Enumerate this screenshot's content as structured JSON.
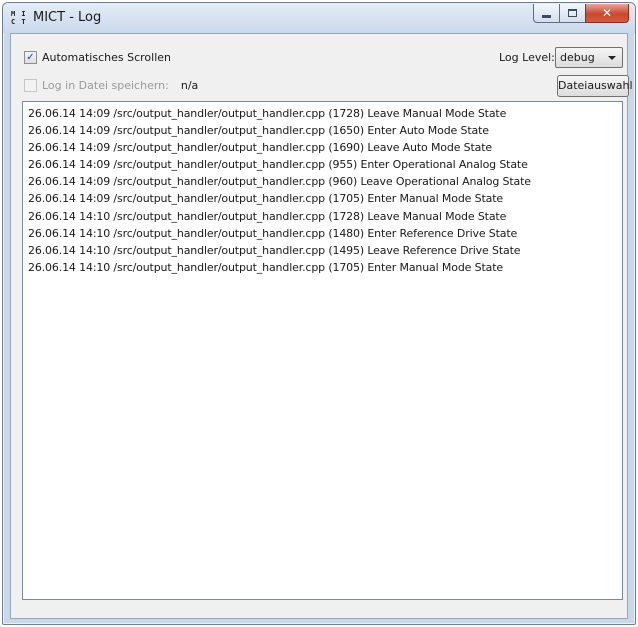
{
  "window": {
    "title": "MICT - Log",
    "app_icon_text": "M I\nC T"
  },
  "controls": {
    "auto_scroll_label": "Automatisches Scrollen",
    "auto_scroll_checked": true,
    "save_to_file_label": "Log in Datei speichern:",
    "save_to_file_checked": false,
    "save_path_value": "n/a",
    "log_level_label": "Log Level:",
    "log_level_value": "debug",
    "file_select_button": "Dateiauswahl"
  },
  "log": {
    "lines": [
      "26.06.14 14:09 /src/output_handler/output_handler.cpp (1728) Leave Manual Mode State",
      "26.06.14 14:09 /src/output_handler/output_handler.cpp (1650) Enter Auto Mode State",
      "26.06.14 14:09 /src/output_handler/output_handler.cpp (1690) Leave Auto Mode State",
      "26.06.14 14:09 /src/output_handler/output_handler.cpp (955) Enter Operational Analog State",
      "26.06.14 14:09 /src/output_handler/output_handler.cpp (960) Leave Operational Analog State",
      "26.06.14 14:09 /src/output_handler/output_handler.cpp (1705) Enter Manual Mode State",
      "26.06.14 14:10 /src/output_handler/output_handler.cpp (1728) Leave Manual Mode State",
      "26.06.14 14:10 /src/output_handler/output_handler.cpp (1480) Enter Reference Drive State",
      "26.06.14 14:10 /src/output_handler/output_handler.cpp (1495) Leave Reference Drive State",
      "26.06.14 14:10 /src/output_handler/output_handler.cpp (1705) Enter Manual Mode State"
    ]
  },
  "icons": {
    "minimize": "minimize-icon",
    "maximize": "maximize-icon",
    "close": "close-icon",
    "checkmark": "checkmark-icon",
    "dropdown": "chevron-down-icon"
  },
  "colors": {
    "close_button": "#c9482f",
    "titlebar": "#cad9ec"
  }
}
